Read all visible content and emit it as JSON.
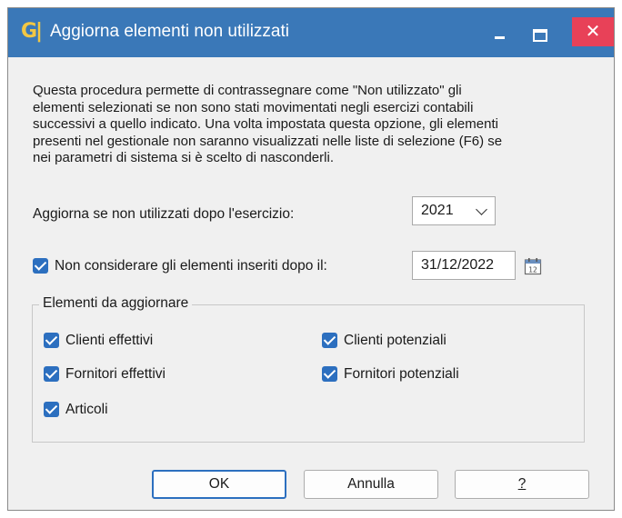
{
  "window": {
    "title": "Aggiorna elementi non utilizzati",
    "close_glyph": "✕"
  },
  "description": "Questa procedura permette di contrassegnare come \"Non utilizzato\" gli\nelementi selezionati se non sono stati movimentati negli esercizi contabili\nsuccessivi a quello indicato. Una volta impostata questa opzione, gli elementi\npresenti nel gestionale non saranno visualizzati nelle liste di selezione (F6) se\nnei parametri di sistema si è scelto di nasconderli.",
  "exercise": {
    "label": "Aggiorna se non utilizzati dopo l'esercizio:",
    "value": "2021"
  },
  "date_filter": {
    "label": "Non considerare gli elementi inseriti dopo il:",
    "checked": true,
    "value": "31/12/2022"
  },
  "group": {
    "title": "Elementi da aggiornare",
    "items": [
      {
        "label": "Clienti effettivi",
        "checked": true
      },
      {
        "label": "Clienti potenziali",
        "checked": true
      },
      {
        "label": "Fornitori effettivi",
        "checked": true
      },
      {
        "label": "Fornitori potenziali",
        "checked": true
      },
      {
        "label": "Articoli",
        "checked": true
      }
    ]
  },
  "buttons": {
    "ok": "OK",
    "cancel": "Annulla",
    "help": "?"
  },
  "colors": {
    "titlebar": "#3a78b8",
    "close": "#e84158",
    "accent": "#2c6fbf"
  },
  "icons": [
    "app-logo-icon",
    "minimize-icon",
    "maximize-icon",
    "close-icon",
    "calendar-icon",
    "chevron-down-icon",
    "checkmark-icon"
  ]
}
